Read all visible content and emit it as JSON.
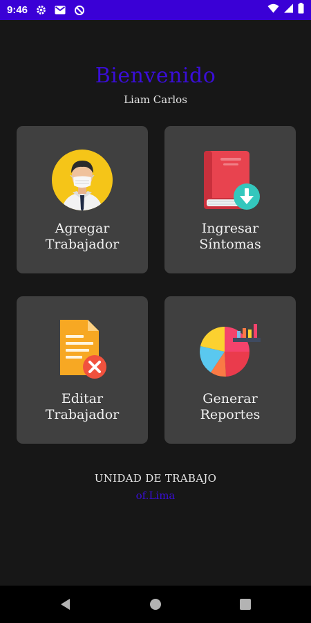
{
  "status_bar": {
    "time": "9:46",
    "left_icons": [
      "settings-icon",
      "gmail-icon",
      "data-saver-icon"
    ],
    "right_icons": [
      "wifi-icon",
      "signal-icon",
      "battery-icon"
    ],
    "background": "#3a00d6"
  },
  "header": {
    "title": "Bienvenido",
    "user_name": "Liam Carlos",
    "title_color": "#3a0ed8"
  },
  "menu": {
    "cards": [
      {
        "label_line1": "Agregar",
        "label_line2": "Trabajador",
        "icon": "worker-avatar-icon"
      },
      {
        "label_line1": "Ingresar",
        "label_line2": "Síntomas",
        "icon": "book-download-icon"
      },
      {
        "label_line1": "Editar",
        "label_line2": "Trabajador",
        "icon": "document-delete-icon"
      },
      {
        "label_line1": "Generar",
        "label_line2": "Reportes",
        "icon": "pie-chart-icon"
      }
    ]
  },
  "footer": {
    "unit_title": "UNIDAD DE TRABAJO",
    "unit_value": "of.Lima"
  },
  "nav_bar": {
    "buttons": [
      "back-icon",
      "home-icon",
      "recents-icon"
    ]
  }
}
